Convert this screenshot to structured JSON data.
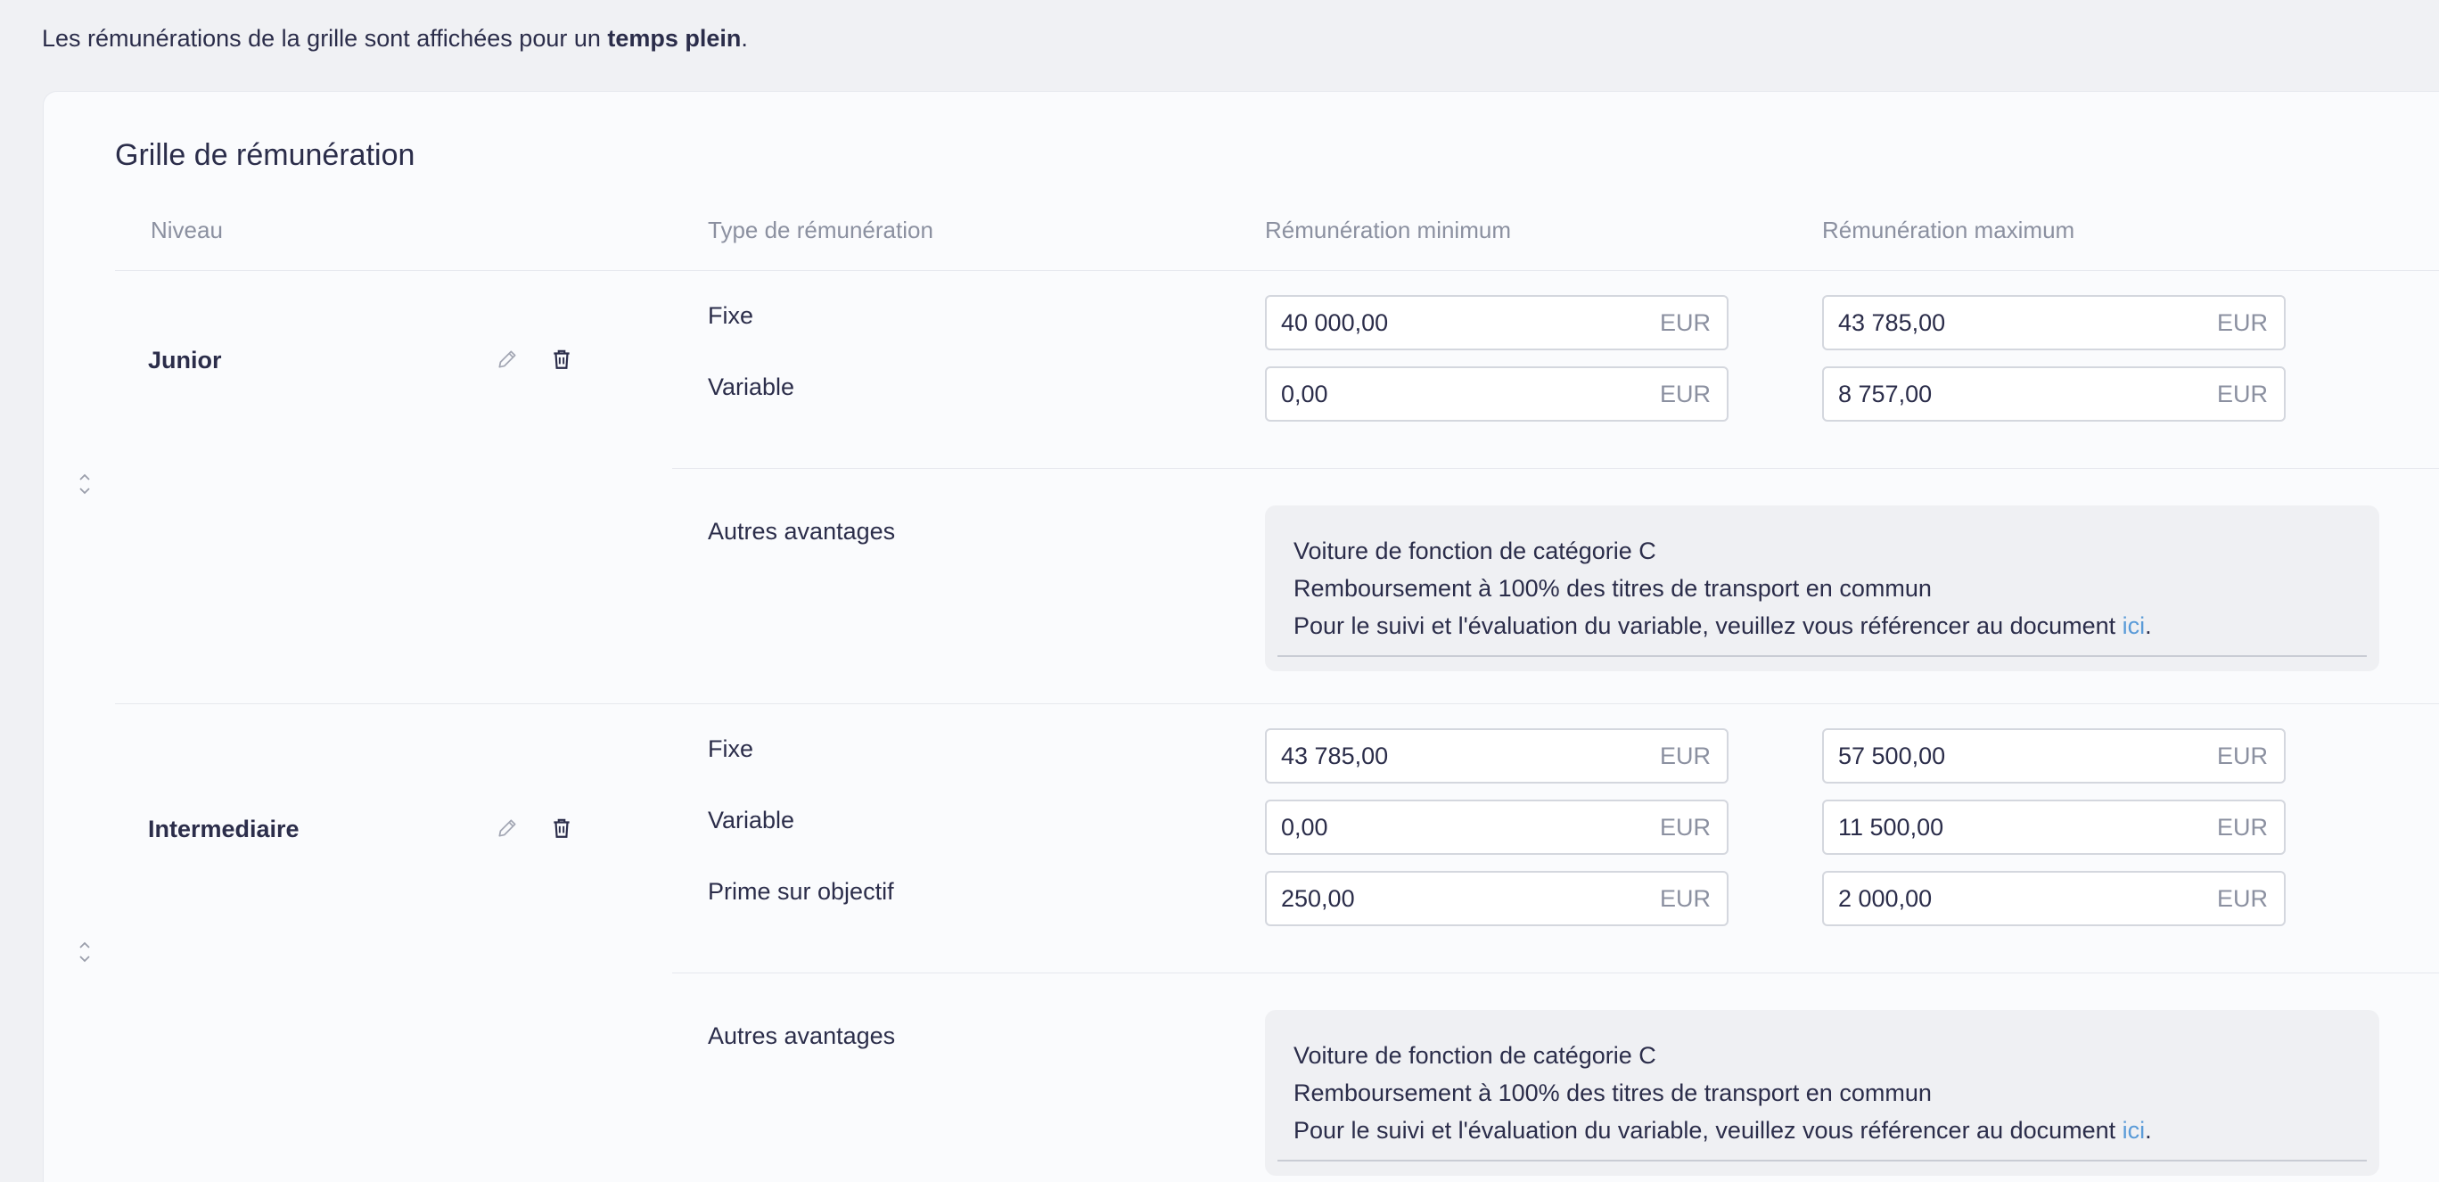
{
  "intro": {
    "text_before": "Les rémunérations de la grille sont affichées pour un ",
    "bold": "temps plein",
    "text_after": "."
  },
  "grid": {
    "title": "Grille de rémunération",
    "columns": {
      "level": "Niveau",
      "type": "Type de rémunération",
      "min": "Rémunération minimum",
      "max": "Rémunération maximum"
    },
    "currency": "EUR",
    "levels": [
      {
        "name": "Junior",
        "rows": [
          {
            "type": "Fixe",
            "min": "40 000,00",
            "max": "43 785,00"
          },
          {
            "type": "Variable",
            "min": "0,00",
            "max": "8 757,00"
          }
        ],
        "benefits_label": "Autres avantages",
        "benefits": {
          "line1": "Voiture de fonction de catégorie C",
          "line2": "Remboursement à 100% des titres de transport en commun",
          "line3": "Pour le suivi et l'évaluation du variable, veuillez vous référencer au document ",
          "link": "ici",
          "line3_end": "."
        }
      },
      {
        "name": "Intermediaire",
        "rows": [
          {
            "type": "Fixe",
            "min": "43 785,00",
            "max": "57 500,00"
          },
          {
            "type": "Variable",
            "min": "0,00",
            "max": "11 500,00"
          },
          {
            "type": "Prime sur objectif",
            "min": "250,00",
            "max": "2 000,00"
          }
        ],
        "benefits_label": "Autres avantages",
        "benefits": {
          "line1": "Voiture de fonction de catégorie C",
          "line2": "Remboursement à 100% des titres de transport en commun",
          "line3": "Pour le suivi et l'évaluation du variable, veuillez vous référencer au document ",
          "link": "ici",
          "line3_end": "."
        }
      }
    ]
  },
  "icons": {
    "edit": "pencil-icon",
    "delete": "trash-icon",
    "drag": "drag-handle-icon"
  }
}
